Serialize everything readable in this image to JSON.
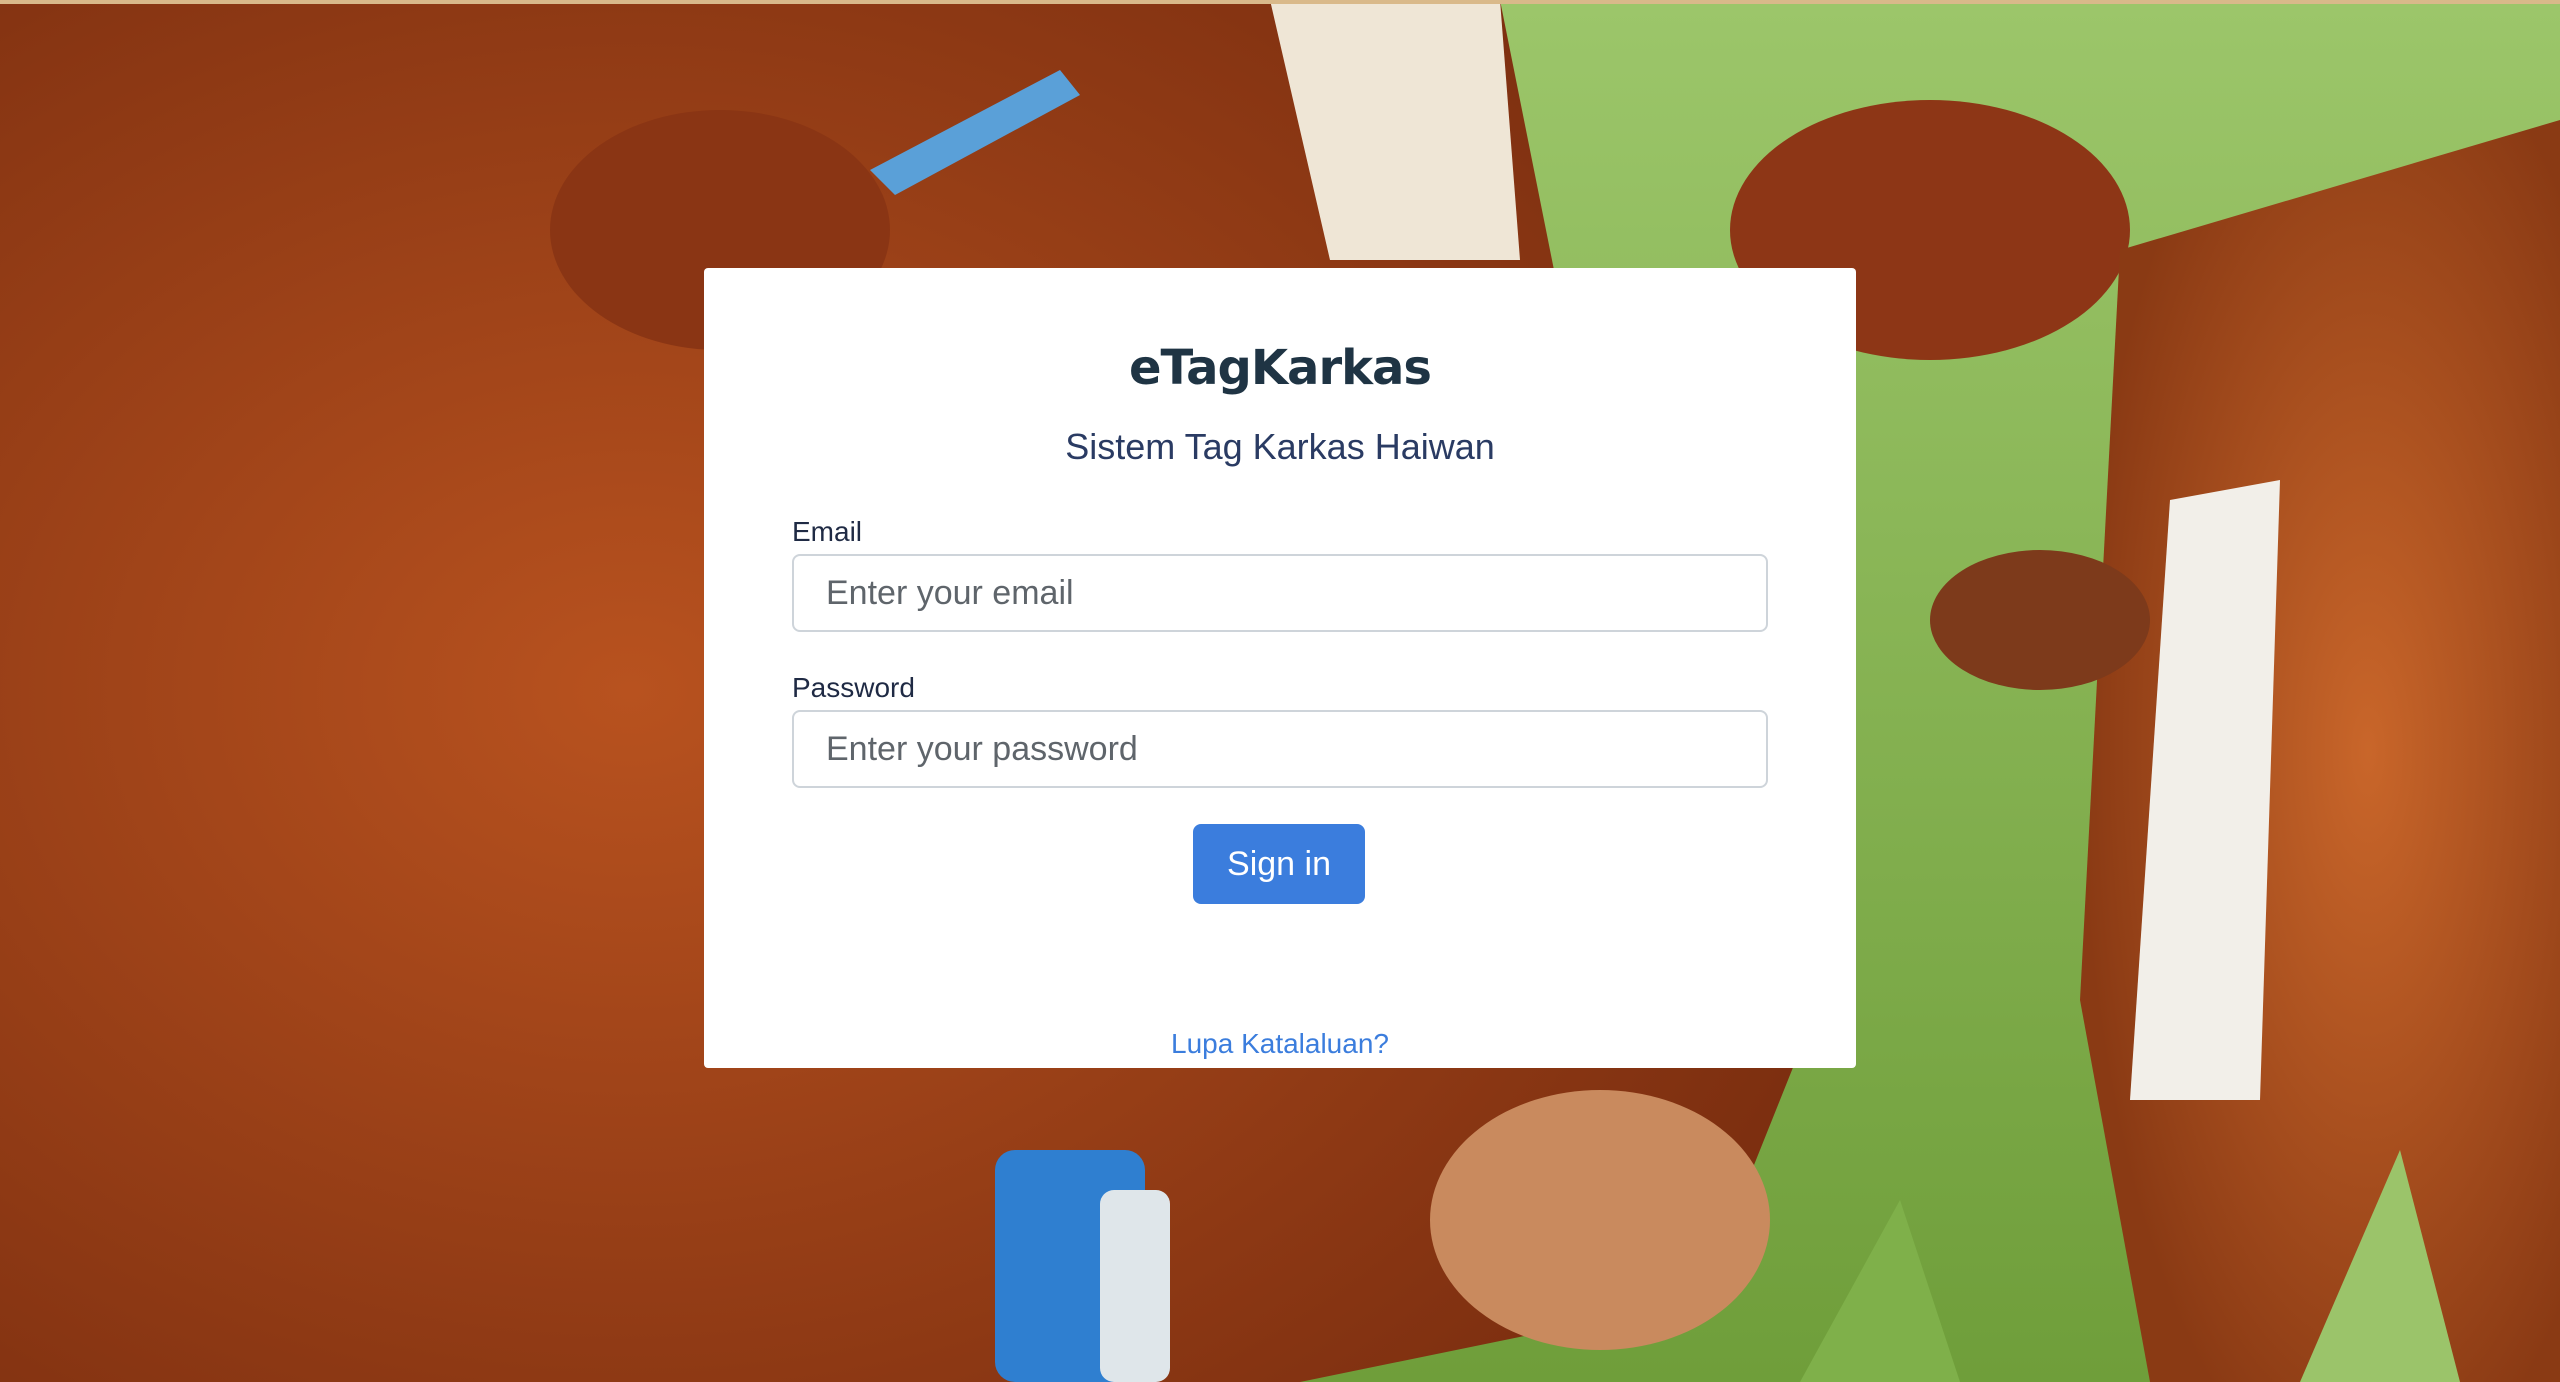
{
  "login": {
    "brand": "eTagKarkas",
    "subtitle": "Sistem Tag Karkas Haiwan",
    "email_label": "Email",
    "email_placeholder": "Enter your email",
    "email_value": "",
    "password_label": "Password",
    "password_placeholder": "Enter your password",
    "password_value": "",
    "signin_label": "Sign in",
    "forgot_label": "Lupa Katalaluan?"
  },
  "colors": {
    "accent": "#3b7ddd",
    "card_bg": "#ffffff",
    "brand_text": "#1f3444"
  }
}
